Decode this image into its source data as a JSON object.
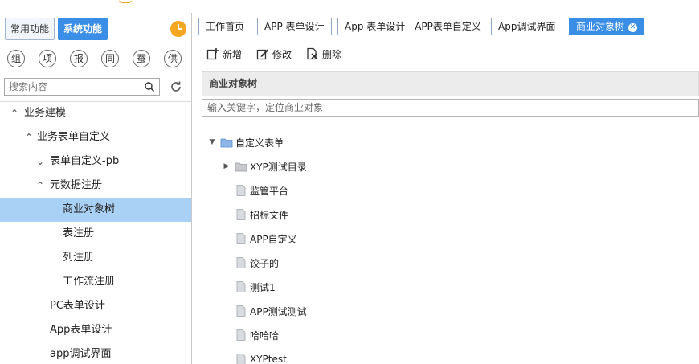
{
  "sidebar": {
    "tabs": [
      "常用功能",
      "系统功能"
    ],
    "active_tab": 1,
    "quick_circles": [
      "组",
      "项",
      "报",
      "同",
      "蚕",
      "供"
    ],
    "search": {
      "placeholder": "搜索内容"
    },
    "tree": [
      {
        "label": "业务建模",
        "expanded": true
      },
      {
        "label": "业务表单自定义",
        "expanded": true
      },
      {
        "label": "表单自定义-pb",
        "expanded": false
      },
      {
        "label": "元数据注册",
        "expanded": true
      },
      {
        "label": "商业对象树",
        "selected": true
      },
      {
        "label": "表注册"
      },
      {
        "label": "列注册"
      },
      {
        "label": "工作流注册"
      },
      {
        "label": "PC表单设计"
      },
      {
        "label": "App表单设计"
      },
      {
        "label": "app调试界面"
      }
    ]
  },
  "tabs": [
    {
      "label": "工作首页"
    },
    {
      "label": "APP 表单设计"
    },
    {
      "label": "App 表单设计 - APP表单自定义"
    },
    {
      "label": "App调试界面"
    },
    {
      "label": "商业对象树",
      "active": true
    }
  ],
  "toolbar": {
    "add_label": "新增",
    "edit_label": "修改",
    "delete_label": "删除"
  },
  "panel": {
    "title": "商业对象树",
    "filter_placeholder": "输入关键字，定位商业对象"
  },
  "object_tree": {
    "root": {
      "label": "自定义表单",
      "expanded": true
    },
    "children": [
      {
        "label": "XYP测试目录",
        "type": "folder",
        "expanded": false
      },
      {
        "label": "监管平台",
        "type": "file"
      },
      {
        "label": "招标文件",
        "type": "file"
      },
      {
        "label": "APP自定义",
        "type": "file"
      },
      {
        "label": "饺子的",
        "type": "file"
      },
      {
        "label": "测试1",
        "type": "file"
      },
      {
        "label": "APP测试测试",
        "type": "file"
      },
      {
        "label": "哈哈哈",
        "type": "file"
      },
      {
        "label": "XYPtest",
        "type": "file"
      }
    ]
  },
  "colors": {
    "accent": "#3a8ee6",
    "selected_row": "#a9d0f5",
    "clock": "#f5a623"
  }
}
